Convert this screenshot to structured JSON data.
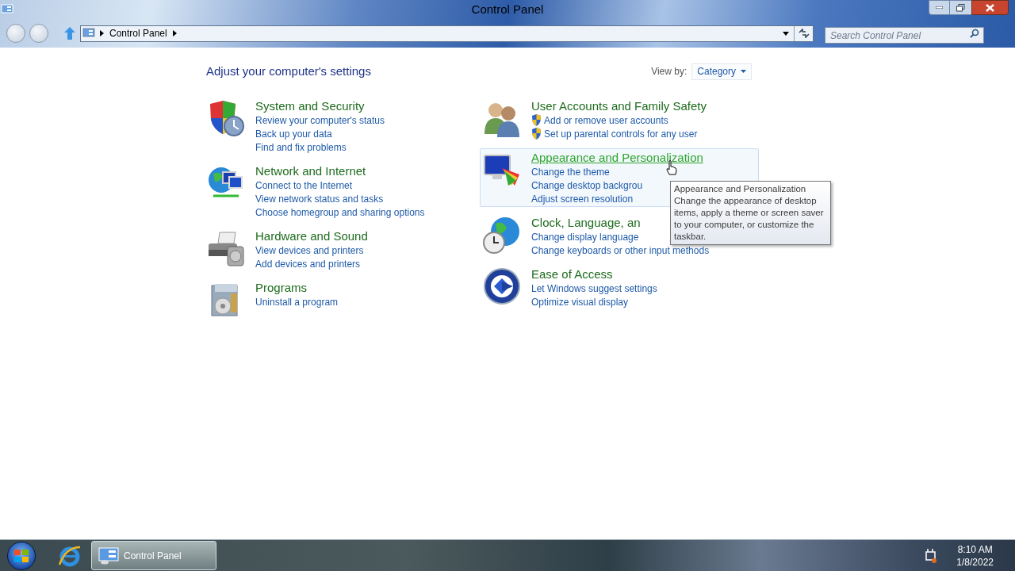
{
  "window": {
    "title": "Control Panel"
  },
  "address_bar": {
    "segments": [
      "Control Panel"
    ]
  },
  "search": {
    "placeholder": "Search Control Panel"
  },
  "heading": "Adjust your computer's settings",
  "view_by": {
    "label": "View by:",
    "value": "Category"
  },
  "left_column": [
    {
      "kind": "security",
      "title": "System and Security",
      "hovered": false,
      "links": [
        {
          "text": "Review your computer's status",
          "shield": false
        },
        {
          "text": "Back up your data",
          "shield": false
        },
        {
          "text": "Find and fix problems",
          "shield": false
        }
      ]
    },
    {
      "kind": "network",
      "title": "Network and Internet",
      "hovered": false,
      "links": [
        {
          "text": "Connect to the Internet",
          "shield": false
        },
        {
          "text": "View network status and tasks",
          "shield": false
        },
        {
          "text": "Choose homegroup and sharing options",
          "shield": false
        }
      ]
    },
    {
      "kind": "hardware",
      "title": "Hardware and Sound",
      "hovered": false,
      "links": [
        {
          "text": "View devices and printers",
          "shield": false
        },
        {
          "text": "Add devices and printers",
          "shield": false
        }
      ]
    },
    {
      "kind": "programs",
      "title": "Programs",
      "hovered": false,
      "links": [
        {
          "text": "Uninstall a program",
          "shield": false
        }
      ]
    }
  ],
  "right_column": [
    {
      "kind": "users",
      "title": "User Accounts and Family Safety",
      "hovered": false,
      "links": [
        {
          "text": "Add or remove user accounts",
          "shield": true
        },
        {
          "text": "Set up parental controls for any user",
          "shield": true
        }
      ]
    },
    {
      "kind": "appearance",
      "title": "Appearance and Personalization",
      "hovered": true,
      "links": [
        {
          "text": "Change the theme",
          "shield": false
        },
        {
          "text": "Change desktop backgrou",
          "shield": false
        },
        {
          "text": "Adjust screen resolution",
          "shield": false
        }
      ]
    },
    {
      "kind": "clock",
      "title": "Clock, Language, an",
      "hovered": false,
      "links": [
        {
          "text": "Change display language",
          "shield": false
        },
        {
          "text": "Change keyboards or other input methods",
          "shield": false
        }
      ]
    },
    {
      "kind": "access",
      "title": "Ease of Access",
      "hovered": false,
      "links": [
        {
          "text": "Let Windows suggest settings",
          "shield": false
        },
        {
          "text": "Optimize visual display",
          "shield": false
        }
      ]
    }
  ],
  "tooltip": {
    "title": "Appearance and Personalization",
    "text": "Change the appearance of desktop items, apply a theme or screen saver to your computer, or customize the taskbar."
  },
  "taskbar": {
    "tasks": [
      {
        "label": "Control Panel",
        "selected": true
      }
    ],
    "clock": {
      "time": "8:10 AM",
      "date": "1/8/2022"
    }
  }
}
